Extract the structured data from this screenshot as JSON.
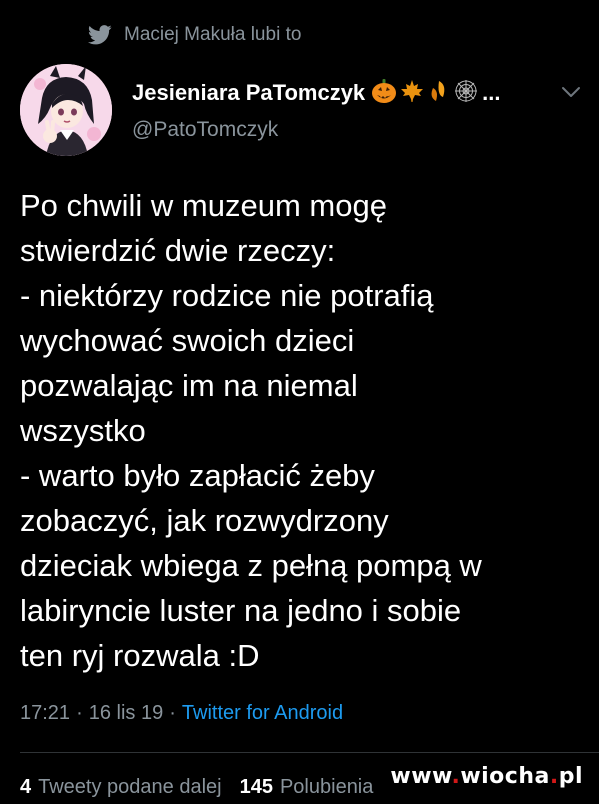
{
  "social_context": {
    "icon": "twitter-bird-icon",
    "text": "Maciej Makuła lubi to"
  },
  "author": {
    "display_name": "Jesieniara PaTomczyk",
    "emojis": [
      "jack-o-lantern-icon",
      "maple-leaf-icon",
      "fallen-leaves-icon",
      "spider-web-icon"
    ],
    "ellipsis": "...",
    "handle": "@PatoTomczyk",
    "avatar": "anime-avatar"
  },
  "tweet": {
    "lines": [
      "Po chwili w muzeum mogę",
      "stwierdzić dwie rzeczy:",
      "- niektórzy rodzice nie potrafią",
      "wychować swoich dzieci",
      "pozwalając im na niemal",
      "wszystko",
      "- warto było zapłacić żeby",
      "zobaczyć, jak rozwydrzony",
      "dzieciak wbiega z pełną pompą w",
      "labiryncie luster na jedno i sobie",
      "ten ryj rozwala :D"
    ],
    "time": "17:21",
    "separator": "·",
    "date": "16 lis 19",
    "source": "Twitter for Android"
  },
  "stats": {
    "retweets_count": "4",
    "retweets_label": "Tweety podane dalej",
    "likes_count": "145",
    "likes_label": "Polubienia"
  },
  "watermark": {
    "prefix": "www",
    "dot1": ".",
    "name": "wiocha",
    "dot2": ".",
    "suffix": "pl"
  },
  "colors": {
    "background": "#000000",
    "secondary_text": "#8a949c",
    "link": "#1d9bf0",
    "divider": "#2f3336"
  }
}
